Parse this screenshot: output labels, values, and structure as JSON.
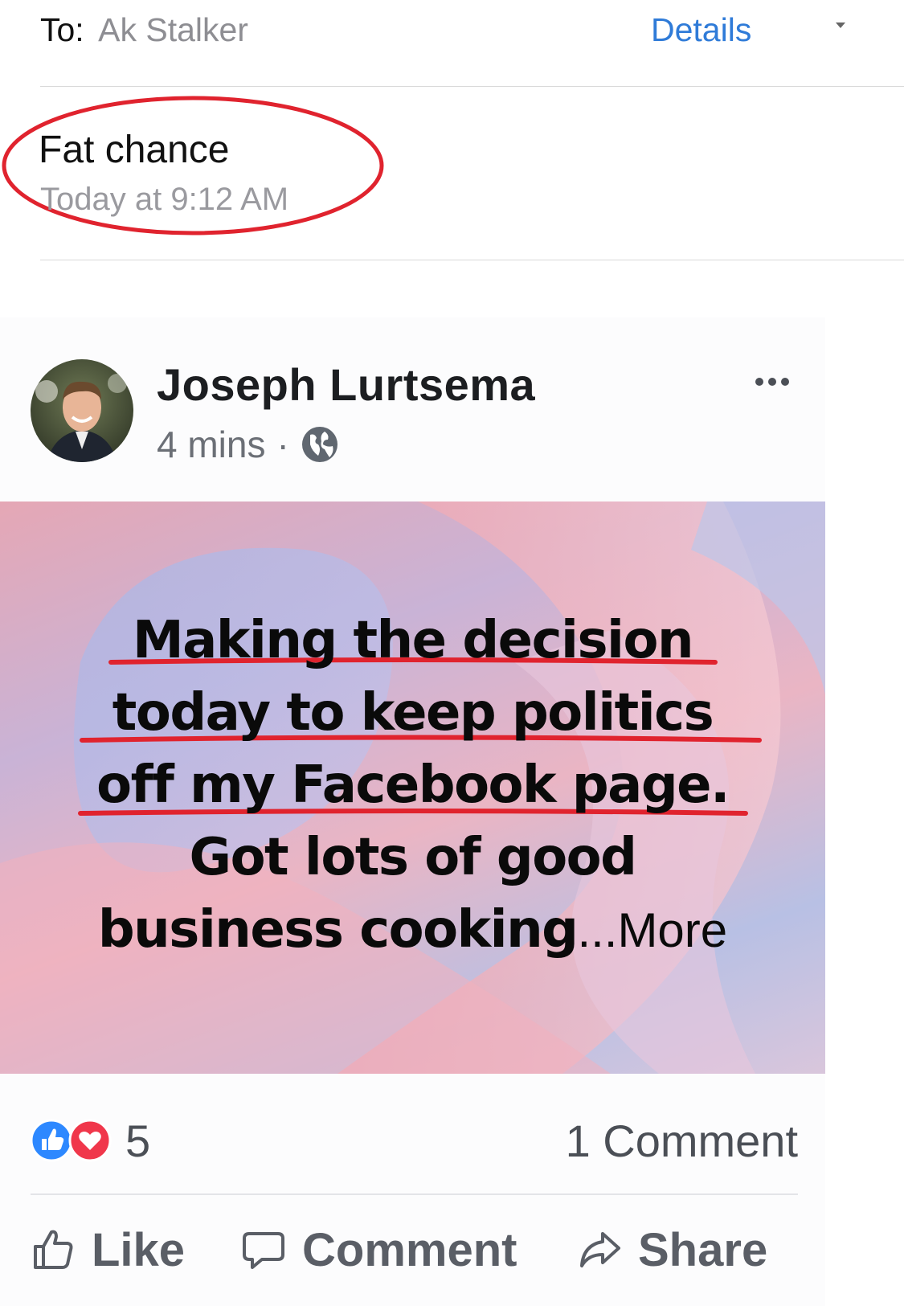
{
  "mail": {
    "to_prefix": "To:",
    "to_name": "Ak Stalker",
    "details_label": "Details",
    "subject": "Fat chance",
    "date": "Today at 9:12 AM"
  },
  "post": {
    "author": "Joseph Lurtsema",
    "time": "4 mins",
    "separator": "·",
    "privacy_icon": "globe-icon",
    "lines": [
      "Making the decision",
      "today to keep politics",
      "off my Facebook page.",
      "Got lots of good",
      "business cooking"
    ],
    "ellipsis": "...",
    "more_label": "More",
    "reaction_count": "5",
    "comment_count": "1 Comment",
    "actions": {
      "like": "Like",
      "comment": "Comment",
      "share": "Share"
    }
  },
  "colors": {
    "link_blue": "#2f7bd8",
    "annotation_red": "#e0232e",
    "like_blue": "#2d88ff",
    "love_red": "#f0374b"
  }
}
